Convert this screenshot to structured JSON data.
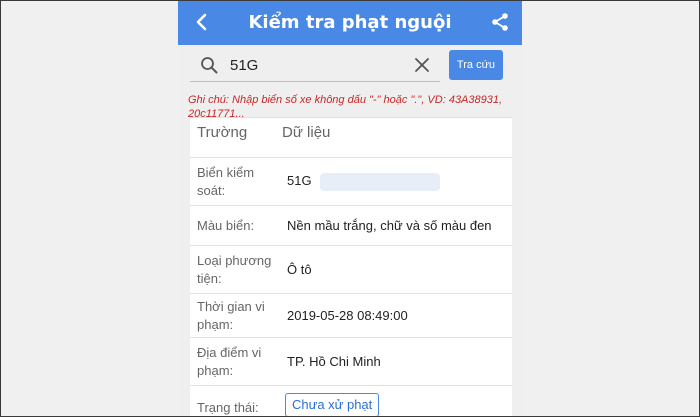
{
  "header": {
    "title": "Kiểm tra phạt nguội",
    "back_icon": "chevron-left-icon",
    "share_icon": "share-icon"
  },
  "search": {
    "value": "51G",
    "lookup_label": "Tra cứu"
  },
  "note": "Ghi chú: Nhập biển số xe không dấu \"-\" hoặc \".\", VD: 43A38931, 20c11771...",
  "table": {
    "header": {
      "field": "Trường",
      "value": "Dữ liệu"
    },
    "rows": [
      {
        "label": "Biển kiểm soát:",
        "value": "51G"
      },
      {
        "label": "Màu biển:",
        "value": "Nền mầu trắng, chữ và số màu đen"
      },
      {
        "label": "Loại phương tiện:",
        "value": "Ô tô"
      },
      {
        "label": "Thời gian vi phạm:",
        "value": "2019-05-28 08:49:00"
      },
      {
        "label": "Địa điểm vi phạm:",
        "value": "TP. Hồ Chi Minh"
      },
      {
        "label": "Trạng thái:",
        "value": "Chưa xử phạt"
      }
    ]
  },
  "colors": {
    "accent": "#4a88e5",
    "note": "#c62828"
  }
}
